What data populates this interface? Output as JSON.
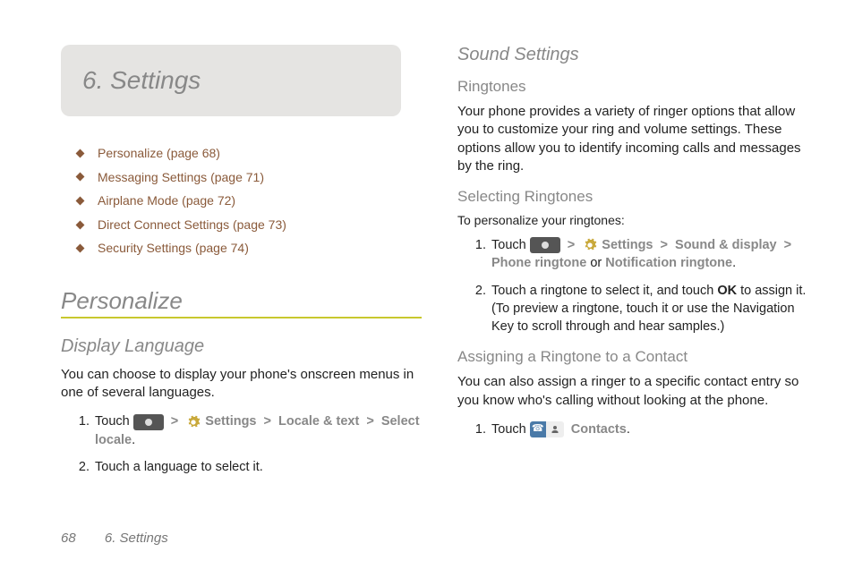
{
  "chapter": {
    "title": "6.  Settings"
  },
  "toc": [
    "Personalize (page 68)",
    "Messaging Settings (page 71)",
    "Airplane Mode (page 72)",
    "Direct Connect Settings (page 73)",
    "Security Settings (page 74)"
  ],
  "left": {
    "personalize_heading": "Personalize",
    "display_language_heading": "Display Language",
    "display_language_body": "You can choose to display your phone's onscreen menus in one of several languages.",
    "step1_prefix": "Touch ",
    "settings_label": "Settings",
    "locale_text_label": "Locale & text",
    "select_locale_label": "Select locale",
    "step2": "Touch a language to select it."
  },
  "right": {
    "sound_settings_heading": "Sound Settings",
    "ringtones_heading": "Ringtones",
    "ringtones_body": "Your phone provides a variety of ringer options that allow you to customize your ring and volume settings. These options allow you to identify incoming calls and messages by the ring.",
    "selecting_heading": "Selecting Ringtones",
    "selecting_lead": "To personalize your ringtones:",
    "sel_step1_prefix": "Touch ",
    "settings_label": "Settings",
    "sound_display_label": "Sound & display",
    "phone_ringtone_label": "Phone ringtone",
    "or_word": " or ",
    "notification_ringtone_label": "Notification ringtone",
    "sel_step2_a": "Touch a ringtone to select it, and touch ",
    "ok_label": "OK",
    "sel_step2_b": " to assign it. (To preview a ringtone, touch it or use the Navigation Key to scroll through and hear samples.)",
    "assign_heading": "Assigning a Ringtone to a Contact",
    "assign_body": "You can also assign a ringer to a specific contact entry so you know who's calling without looking at the phone.",
    "assign_step1_prefix": "Touch ",
    "contacts_label": "Contacts"
  },
  "footer": {
    "page_number": "68",
    "chapter_ref": "6. Settings"
  },
  "period": "."
}
